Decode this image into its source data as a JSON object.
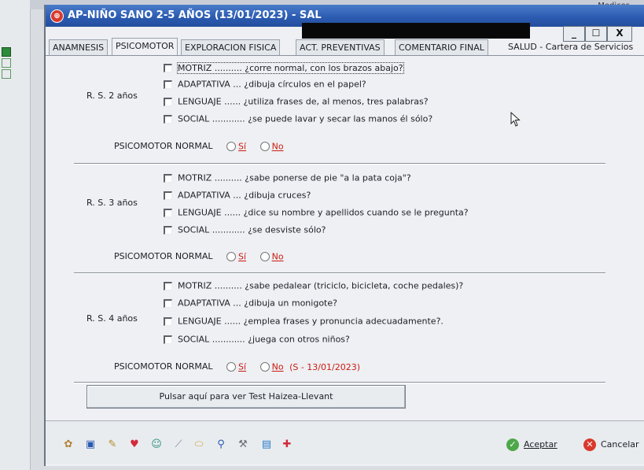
{
  "background": {
    "medicos_label": "Medicos"
  },
  "window": {
    "title": "AP-NIÑO SANO 2-5 AÑOS (13/01/2023) - SAL",
    "controls": {
      "minimize": "_",
      "maximize": "☐",
      "close": "X"
    }
  },
  "tabs": [
    {
      "label": "ANAMNESIS",
      "active": false
    },
    {
      "label": "PSICOMOTOR",
      "active": true
    },
    {
      "label": "EXPLORACION FISICA",
      "active": false
    },
    {
      "label": "ACT. PREVENTIVAS",
      "active": false
    },
    {
      "label": "COMENTARIO FINAL",
      "active": false
    },
    {
      "label": "SALUD - Cartera de Servicios",
      "active": false
    }
  ],
  "groups": [
    {
      "label": "R. S. 2 años",
      "items": [
        {
          "area": "MOTRIZ ..........",
          "question": "¿corre normal, con los brazos abajo?",
          "checked": false
        },
        {
          "area": "ADAPTATIVA ...",
          "question": "¿dibuja círculos en el papel?",
          "checked": false
        },
        {
          "area": "LENGUAJE ......",
          "question": "¿utiliza frases de, al menos, tres palabras?",
          "checked": false
        },
        {
          "area": "SOCIAL ............",
          "question": "¿se puede lavar y secar las manos él sólo?",
          "checked": false
        }
      ],
      "normal": {
        "label": "PSICOMOTOR NORMAL",
        "yes": "Sí",
        "no": "No",
        "note": ""
      }
    },
    {
      "label": "R. S. 3 años",
      "items": [
        {
          "area": "MOTRIZ ..........",
          "question": "¿sabe ponerse de pie \"a la pata coja\"?",
          "checked": false
        },
        {
          "area": "ADAPTATIVA ...",
          "question": "¿dibuja cruces?",
          "checked": false
        },
        {
          "area": "LENGUAJE ......",
          "question": "¿dice su nombre y apellidos cuando se le pregunta?",
          "checked": false
        },
        {
          "area": "SOCIAL ............",
          "question": "¿se desviste sólo?",
          "checked": false
        }
      ],
      "normal": {
        "label": "PSICOMOTOR NORMAL",
        "yes": "Sí",
        "no": "No",
        "note": ""
      }
    },
    {
      "label": "R. S. 4 años",
      "items": [
        {
          "area": "MOTRIZ ..........",
          "question": "¿sabe pedalear (triciclo, bicicleta, coche pedales)?",
          "checked": false
        },
        {
          "area": "ADAPTATIVA ...",
          "question": "¿dibuja un monigote?",
          "checked": false
        },
        {
          "area": "LENGUAJE ......",
          "question": "¿emplea frases y pronuncia adecuadamente?.",
          "checked": false
        },
        {
          "area": "SOCIAL ............",
          "question": "¿juega con otros niños?",
          "checked": false
        }
      ],
      "normal": {
        "label": "PSICOMOTOR NORMAL",
        "yes": "Sí",
        "no": "No",
        "note": "(S - 13/01/2023)"
      }
    }
  ],
  "haizea_button": "Pulsar aquí para ver Test Haizea-Llevant",
  "toolbar": {
    "tools": [
      "users-icon",
      "monitor-icon",
      "pen-icon",
      "heart-icon",
      "search-person-icon",
      "pipette-icon",
      "pill-icon",
      "magnifier-icon",
      "tools-icon",
      "document-icon",
      "first-aid-icon"
    ],
    "accept_label": "Aceptar",
    "cancel_label": "Cancelar"
  },
  "colors": {
    "accent": "#cc1a10",
    "title_bar": "#2a5ab0"
  }
}
